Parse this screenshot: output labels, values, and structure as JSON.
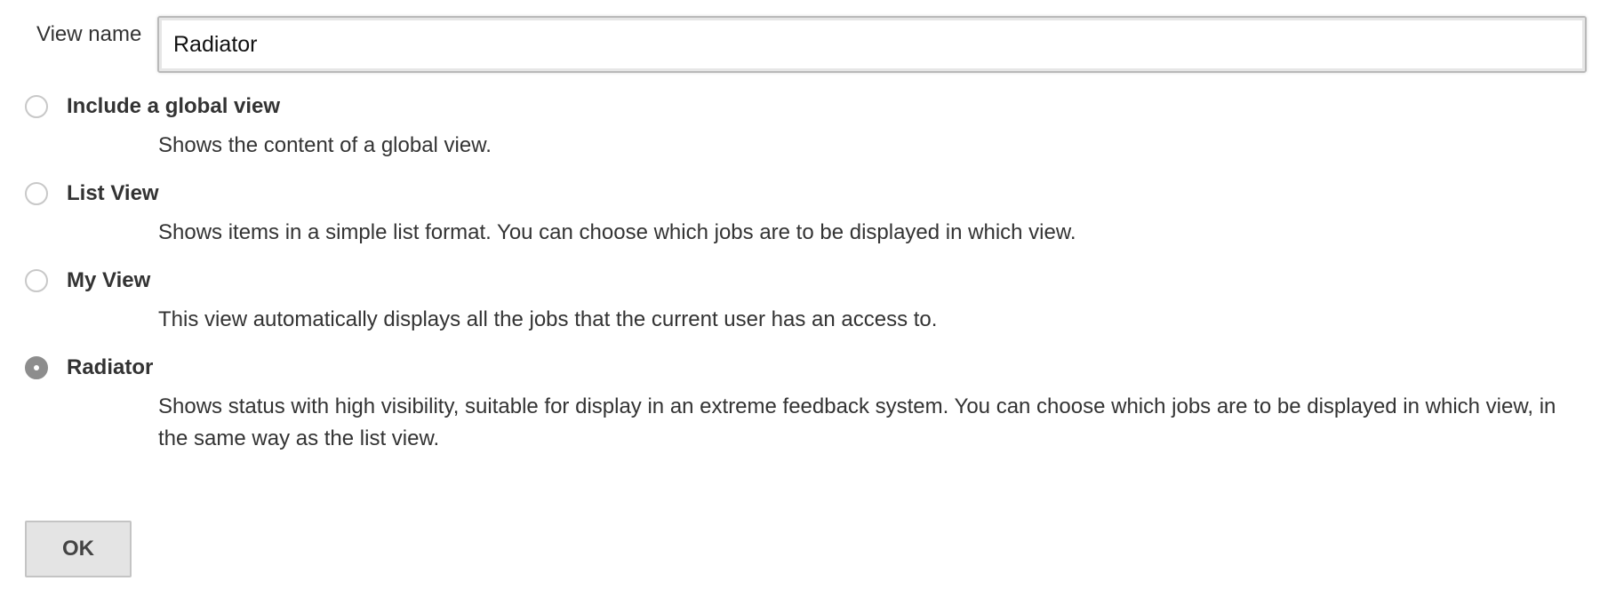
{
  "form": {
    "view_name_label": "View name",
    "view_name_value": "Radiator"
  },
  "options": [
    {
      "label": "Include a global view",
      "description": "Shows the content of a global view.",
      "checked": false
    },
    {
      "label": "List View",
      "description": "Shows items in a simple list format. You can choose which jobs are to be displayed in which view.",
      "checked": false
    },
    {
      "label": "My View",
      "description": "This view automatically displays all the jobs that the current user has an access to.",
      "checked": false
    },
    {
      "label": "Radiator",
      "description": "Shows status with high visibility, suitable for display in an extreme feedback system. You can choose which jobs are to be displayed in which view, in the same way as the list view.",
      "checked": true
    }
  ],
  "actions": {
    "ok_label": "OK"
  },
  "colors": {
    "text": "#333333",
    "radio_checked": "#8d8d8d",
    "button_bg": "#e4e4e4"
  }
}
